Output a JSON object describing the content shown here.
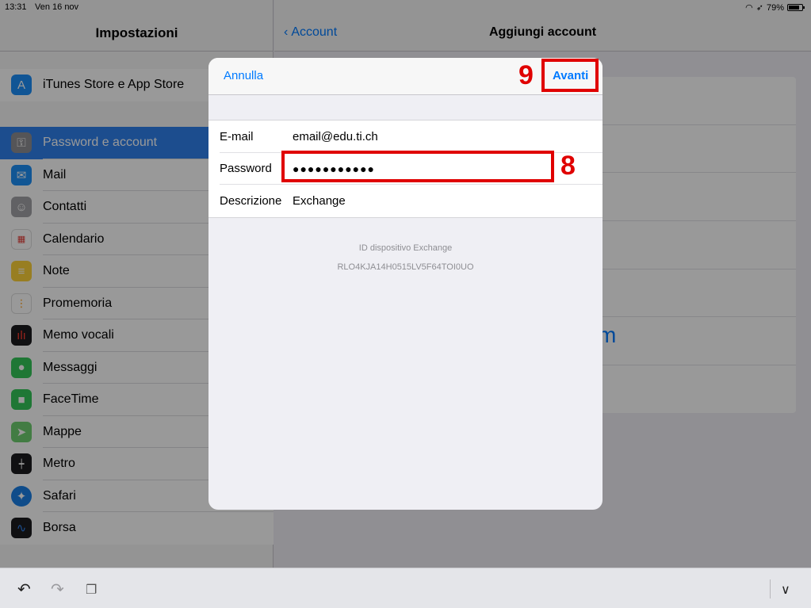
{
  "status_bar": {
    "time": "13:31",
    "date": "Ven 16 nov",
    "battery": "79%",
    "battery_level": 0.79
  },
  "sidebar": {
    "title": "Impostazioni",
    "top_item": {
      "label": "iTunes Store e App Store",
      "icon": "app-store-icon",
      "color": "#1c8ef9"
    },
    "items": [
      {
        "label": "Password e account",
        "icon": "key-icon",
        "color": "#8e8e93",
        "selected": true
      },
      {
        "label": "Mail",
        "icon": "mail-icon",
        "color": "#1d8ff7"
      },
      {
        "label": "Contatti",
        "icon": "contacts-icon",
        "color": "#a2a2a7"
      },
      {
        "label": "Calendario",
        "icon": "calendar-icon",
        "color": "#ffffff"
      },
      {
        "label": "Note",
        "icon": "notes-icon",
        "color": "#fdd23a"
      },
      {
        "label": "Promemoria",
        "icon": "reminders-icon",
        "color": "#ffffff"
      },
      {
        "label": "Memo vocali",
        "icon": "voice-memos-icon",
        "color": "#1c1c1e"
      },
      {
        "label": "Messaggi",
        "icon": "messages-icon",
        "color": "#34c759"
      },
      {
        "label": "FaceTime",
        "icon": "facetime-icon",
        "color": "#34c759"
      },
      {
        "label": "Mappe",
        "icon": "maps-icon",
        "color": "#6fcf70"
      },
      {
        "label": "Metro",
        "icon": "measure-icon",
        "color": "#1c1c1e"
      },
      {
        "label": "Safari",
        "icon": "safari-icon",
        "color": "#1a7fe6"
      },
      {
        "label": "Borsa",
        "icon": "stocks-icon",
        "color": "#1c1c1e"
      }
    ]
  },
  "detail": {
    "back_label": "Account",
    "title": "Aggiungi account",
    "partial_text": "m"
  },
  "modal": {
    "cancel_label": "Annulla",
    "next_label": "Avanti",
    "fields": [
      {
        "label": "E-mail",
        "value": "email@edu.ti.ch"
      },
      {
        "label": "Password",
        "value": "●●●●●●●●●●●"
      },
      {
        "label": "Descrizione",
        "value": "Exchange"
      }
    ],
    "device_id_label": "ID dispositivo Exchange",
    "device_id_value": "RLO4KJA14H0515LV5F64TOI0UO"
  },
  "annotations": {
    "next_step": "9",
    "password_step": "8",
    "color": "#e00000"
  }
}
